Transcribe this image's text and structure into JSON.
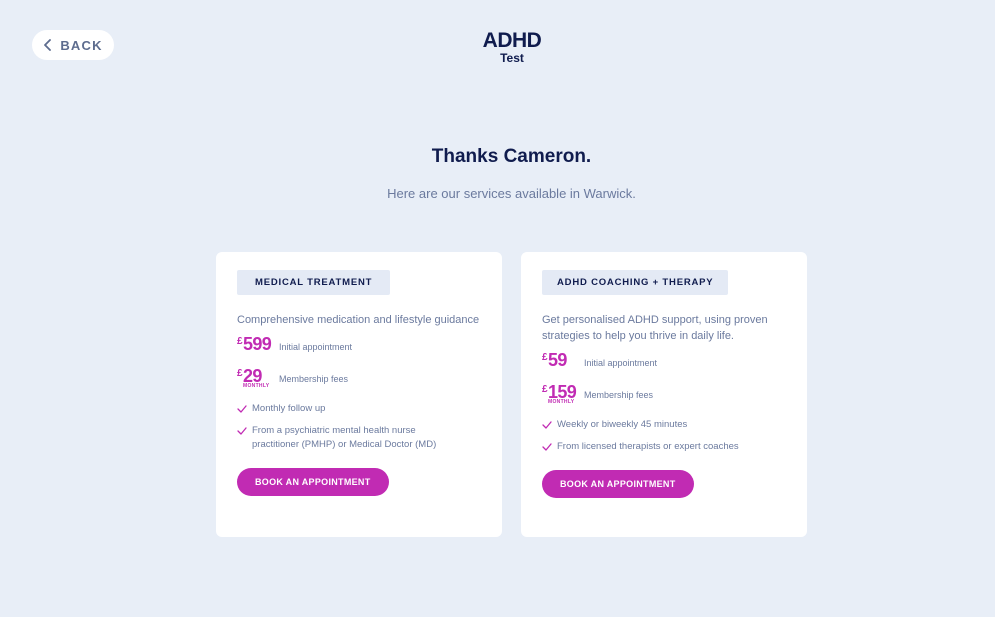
{
  "header": {
    "back_label": "BACK",
    "logo_main": "ADHD",
    "logo_sub": "Test"
  },
  "heading": "Thanks Cameron.",
  "subheading": "Here are our services available in Warwick.",
  "colors": {
    "background": "#e8eef7",
    "accent": "#c12bb3",
    "navy": "#101c4e",
    "muted": "#6b7a9e"
  },
  "cards": [
    {
      "tag": "MEDICAL TREATMENT",
      "description": "Comprehensive medication and lifestyle guidance",
      "prices": [
        {
          "currency": "£",
          "amount": "599",
          "period": "",
          "label": "Initial appointment"
        },
        {
          "currency": "£",
          "amount": "29",
          "period": "MONTHLY",
          "label": "Membership fees"
        }
      ],
      "features": [
        "Monthly follow up",
        "From a psychiatric mental health nurse practitioner (PMHP) or Medical Doctor (MD)"
      ],
      "button": "BOOK AN APPOINTMENT"
    },
    {
      "tag": "ADHD COACHING + THERAPY",
      "description": "Get personalised ADHD support, using proven strategies to help you thrive in daily life.",
      "prices": [
        {
          "currency": "£",
          "amount": "59",
          "period": "",
          "label": "Initial appointment"
        },
        {
          "currency": "£",
          "amount": "159",
          "period": "MONTHLY",
          "label": "Membership fees"
        }
      ],
      "features": [
        "Weekly or biweekly 45 minutes",
        "From licensed therapists or expert coaches"
      ],
      "button": "BOOK AN APPOINTMENT"
    }
  ]
}
